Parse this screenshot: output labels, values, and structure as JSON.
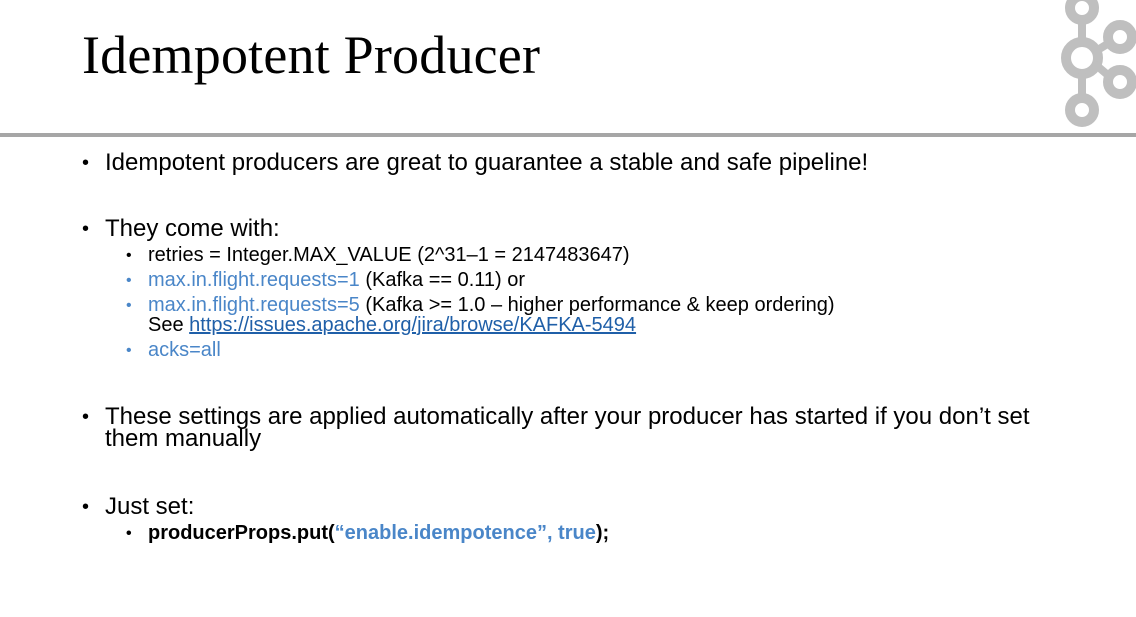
{
  "slide": {
    "title": "Idempotent Producer",
    "bullets": {
      "b1": "Idempotent producers are great to guarantee a stable and safe pipeline!",
      "b2": "They come with:",
      "b2_sub1": "retries = Integer.MAX_VALUE (2^31–1 = 2147483647)",
      "b2_sub2_setting": "max.in.flight.requests=1",
      "b2_sub2_rest": " (Kafka == 0.11) or",
      "b2_sub3_setting": "max.in.flight.requests=5",
      "b2_sub3_rest": " (Kafka >= 1.0 – higher performance & keep ordering)",
      "b2_sub3_see": "See ",
      "b2_sub3_link": "https://issues.apache.org/jira/browse/KAFKA-5494",
      "b2_sub4": "acks=all",
      "b3": "These settings are applied automatically after your producer has started if you don’t set them manually",
      "b4": "Just set:",
      "b4_code_pre": "producerProps.put(",
      "b4_code_args": "“enable.idempotence”, true",
      "b4_code_post": ");"
    },
    "bullet_char": "•",
    "colors": {
      "accent_blue": "#4a86c8",
      "link": "#1f5fa8",
      "divider": "#a6a6a6",
      "logo": "#bfbfbf"
    },
    "logo_icon": "kafka-logo-icon"
  }
}
